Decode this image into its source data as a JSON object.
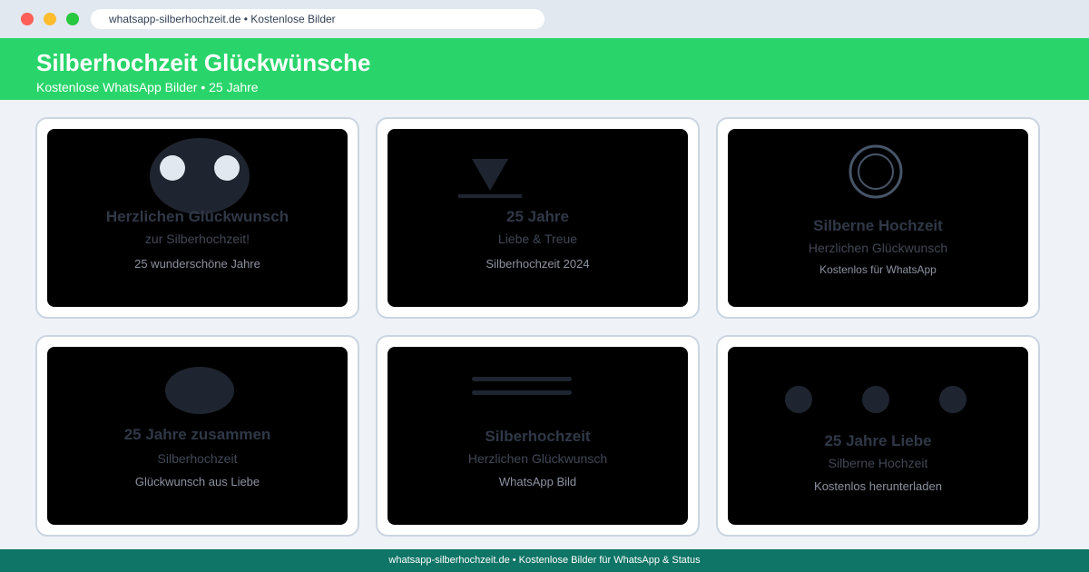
{
  "browser": {
    "url": "whatsapp-silberhochzeit.de • Kostenlose Bilder"
  },
  "hero": {
    "title": "Silberhochzeit Glückwünsche",
    "subtitle": "Kostenlose WhatsApp Bilder • 25 Jahre"
  },
  "cards": [
    {
      "title": "Herzlichen Glückwunsch",
      "subtitle": "zur Silberhochzeit!",
      "caption": "25 wunderschöne Jahre",
      "icon": "face-eyes-icon"
    },
    {
      "title": "25 Jahre",
      "subtitle": "Liebe & Treue",
      "caption": "Silberhochzeit 2024",
      "icon": "triangle-down-icon"
    },
    {
      "title": "Silberne Hochzeit",
      "subtitle": "Herzlichen Glückwunsch",
      "caption": "Kostenlos für WhatsApp",
      "icon": "ring-icon"
    },
    {
      "title": "25 Jahre zusammen",
      "subtitle": "Silberhochzeit",
      "caption": "Glückwunsch aus Liebe",
      "icon": "ellipse-icon"
    },
    {
      "title": "Silberhochzeit",
      "subtitle": "Herzlichen Glückwunsch",
      "caption": "WhatsApp Bild",
      "icon": "lines-icon"
    },
    {
      "title": "25 Jahre Liebe",
      "subtitle": "Silberne Hochzeit",
      "caption": "Kostenlos herunterladen",
      "icon": "three-dots-icon"
    }
  ],
  "footer": {
    "text": "whatsapp-silberhochzeit.de • Kostenlose Bilder für WhatsApp & Status"
  },
  "colors": {
    "brand_green": "#29d56a",
    "footer_teal": "#0f7566",
    "page_bg": "#eff3f8"
  }
}
